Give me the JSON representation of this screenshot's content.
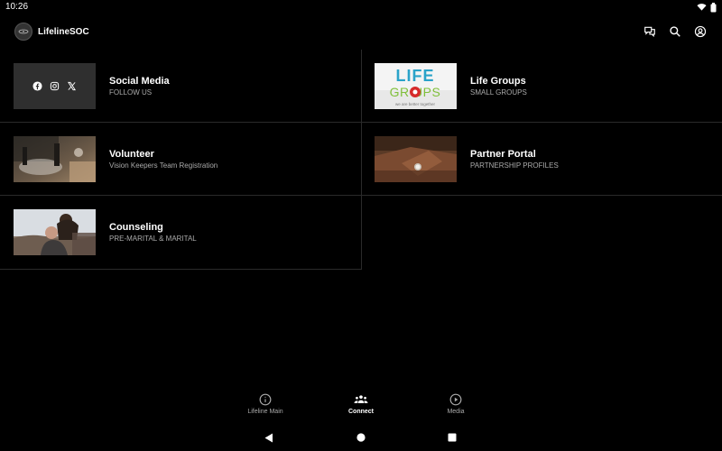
{
  "status_bar": {
    "time": "10:26"
  },
  "app_bar": {
    "title": "LifelineSOC",
    "icons": [
      "chat-icon",
      "search-icon",
      "account-icon"
    ]
  },
  "cards": [
    {
      "title": "Social Media",
      "subtitle": "FOLLOW US",
      "thumb": "social-media-thumbnail"
    },
    {
      "title": "Life Groups",
      "subtitle": "SMALL GROUPS",
      "thumb": "life-groups-thumbnail",
      "thumb_text": "LIFE GROUPS",
      "thumb_tagline": "we are better together"
    },
    {
      "title": "Volunteer",
      "subtitle": "Vision Keepers Team Registration",
      "thumb": "volunteer-photo"
    },
    {
      "title": "Partner Portal",
      "subtitle": "PARTNERSHIP PROFILES",
      "thumb": "partner-portal-photo"
    },
    {
      "title": "Counseling",
      "subtitle": "PRE-MARITAL & MARITAL",
      "thumb": "counseling-photo"
    }
  ],
  "bottom_nav": [
    {
      "label": "Lifeline Main",
      "icon": "info-icon",
      "active": false
    },
    {
      "label": "Connect",
      "icon": "group-icon",
      "active": true
    },
    {
      "label": "Media",
      "icon": "play-circle-icon",
      "active": false
    }
  ],
  "colors": {
    "background": "#000000",
    "divider": "#2a2a2a",
    "life_groups_blue": "#2aa3c9",
    "life_groups_green": "#7fbf3a",
    "life_groups_red": "#d62b2b"
  }
}
